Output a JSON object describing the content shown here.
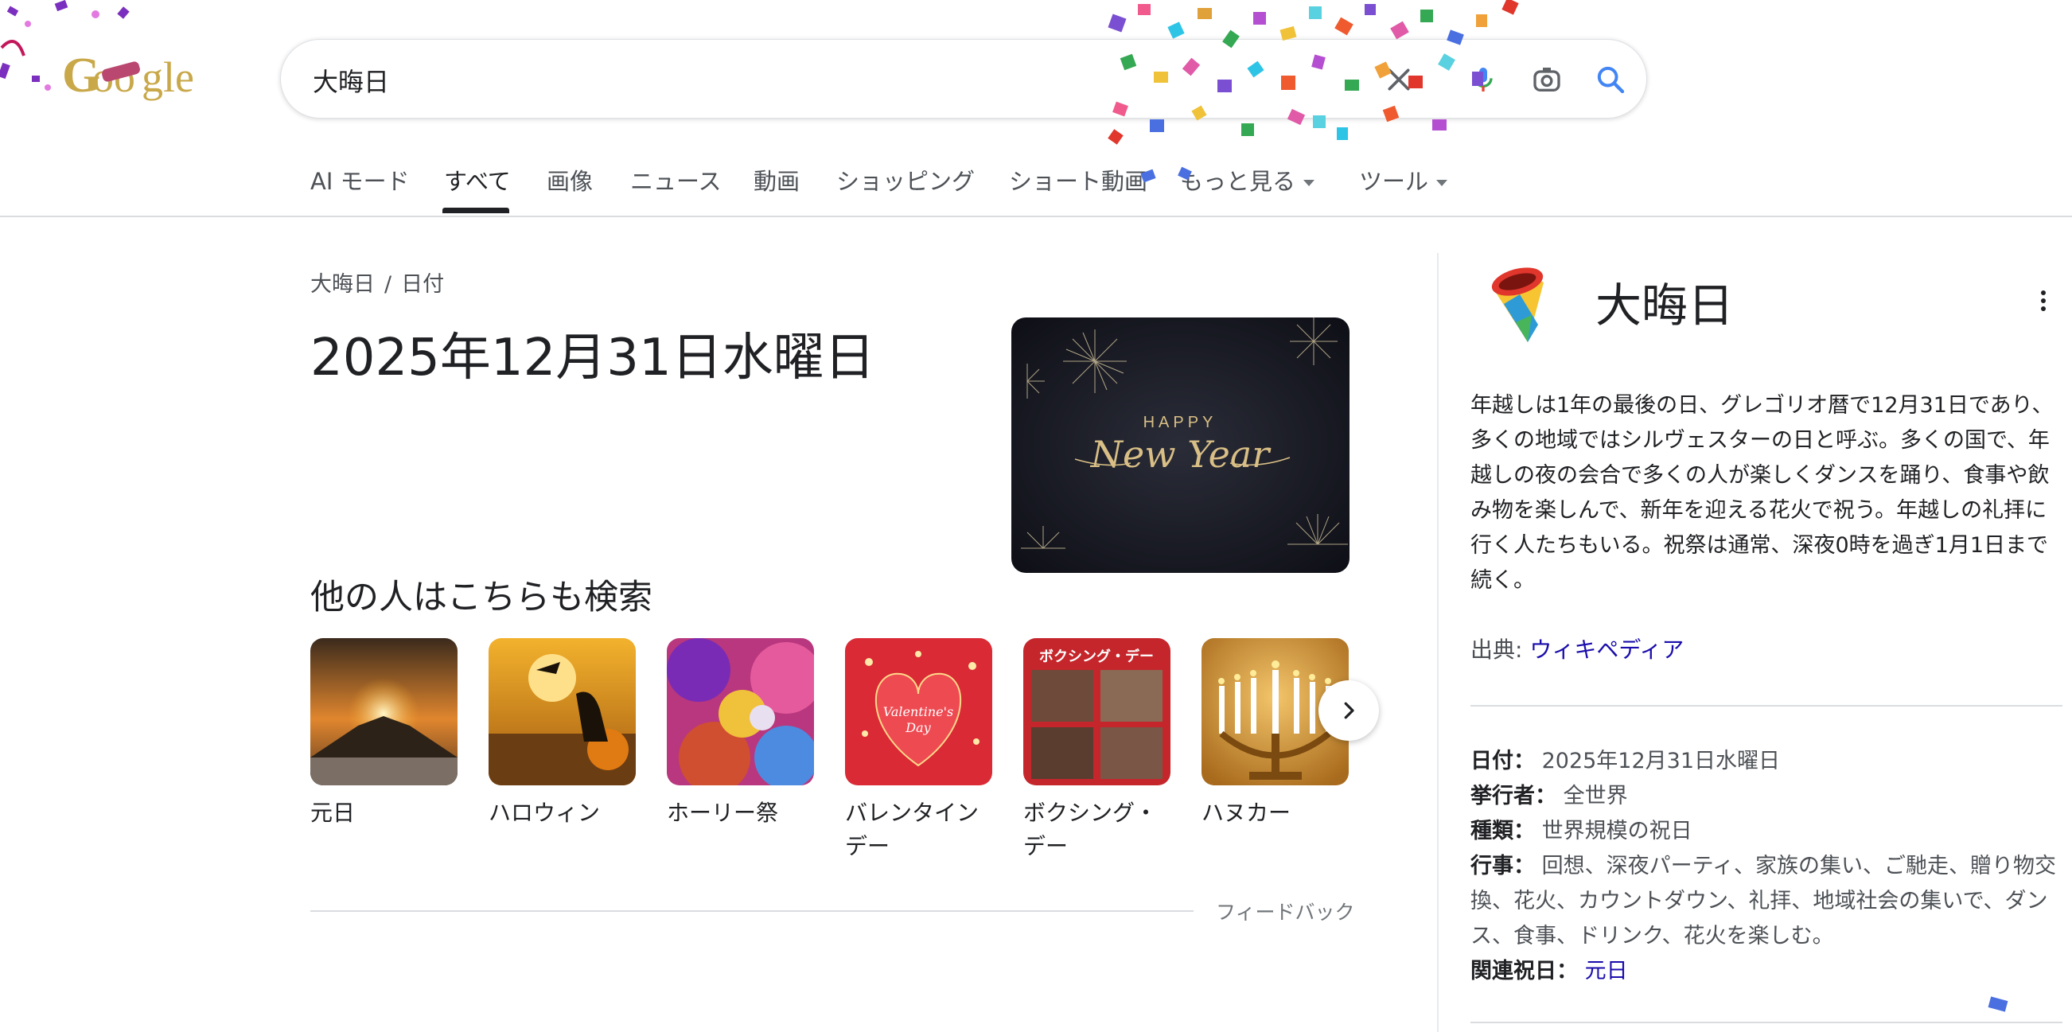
{
  "search": {
    "query": "大晦日",
    "icons": [
      "close-icon",
      "mic-icon",
      "lens-icon",
      "search-icon"
    ]
  },
  "logo": {
    "alt": "Google"
  },
  "tabs": [
    {
      "label": "AI モード"
    },
    {
      "label": "すべて",
      "active": true
    },
    {
      "label": "画像"
    },
    {
      "label": "ニュース"
    },
    {
      "label": "動画"
    },
    {
      "label": "ショッピング"
    },
    {
      "label": "ショート動画"
    },
    {
      "label": "もっと見る"
    },
    {
      "label": "ツール"
    }
  ],
  "answer": {
    "breadcrumb": [
      "大晦日",
      "日付"
    ],
    "breadcrumb_sep": "/",
    "date": "2025年12月31日水曜日",
    "image_text": {
      "top": "HAPPY",
      "main": "New Year"
    }
  },
  "people_also_search": {
    "title": "他の人はこちらも検索",
    "items": [
      {
        "label": "元日",
        "thumb": "sunrise"
      },
      {
        "label": "ハロウィン",
        "thumb": "halloween"
      },
      {
        "label": "ホーリー祭",
        "thumb": "holi"
      },
      {
        "label": "バレンタインデー",
        "thumb": "valentine"
      },
      {
        "label": "ボクシング・デー",
        "thumb": "boxing-day"
      },
      {
        "label": "ハヌカー",
        "thumb": "menorah"
      }
    ],
    "next_icon": "chevron-right-icon"
  },
  "feedback": "フィードバック",
  "knowledge_panel": {
    "title": "大晦日",
    "emoji": "party-popper",
    "description": "年越しは1年の最後の日、グレゴリオ暦で12月31日であり、多くの地域ではシルヴェスターの日と呼ぶ。多くの国で、年越しの夜の会合で多くの人が楽しくダンスを踊り、食事や飲み物を楽しんで、新年を迎える花火で祝う。年越しの礼拝に行く人たちもいる。祝祭は通常、深夜0時を過ぎ1月1日まで続く。",
    "source_label": "出典:",
    "source_link": "ウィキペディア",
    "facts": {
      "date_key": "日付：",
      "date_val": "2025年12月31日水曜日",
      "host_key": "挙行者：",
      "host_val": "全世界",
      "type_key": "種類：",
      "type_val": "世界規模の祝日",
      "events_key": "行事：",
      "events_val": "回想、深夜パーティ、家族の集い、ご馳走、贈り物交換、花火、カウントダウン、礼拝、地域社会の集いで、ダンス、食事、ドリンク、花火を楽しむ。",
      "related_key": "関連祝日：",
      "related_val": "元日"
    }
  }
}
